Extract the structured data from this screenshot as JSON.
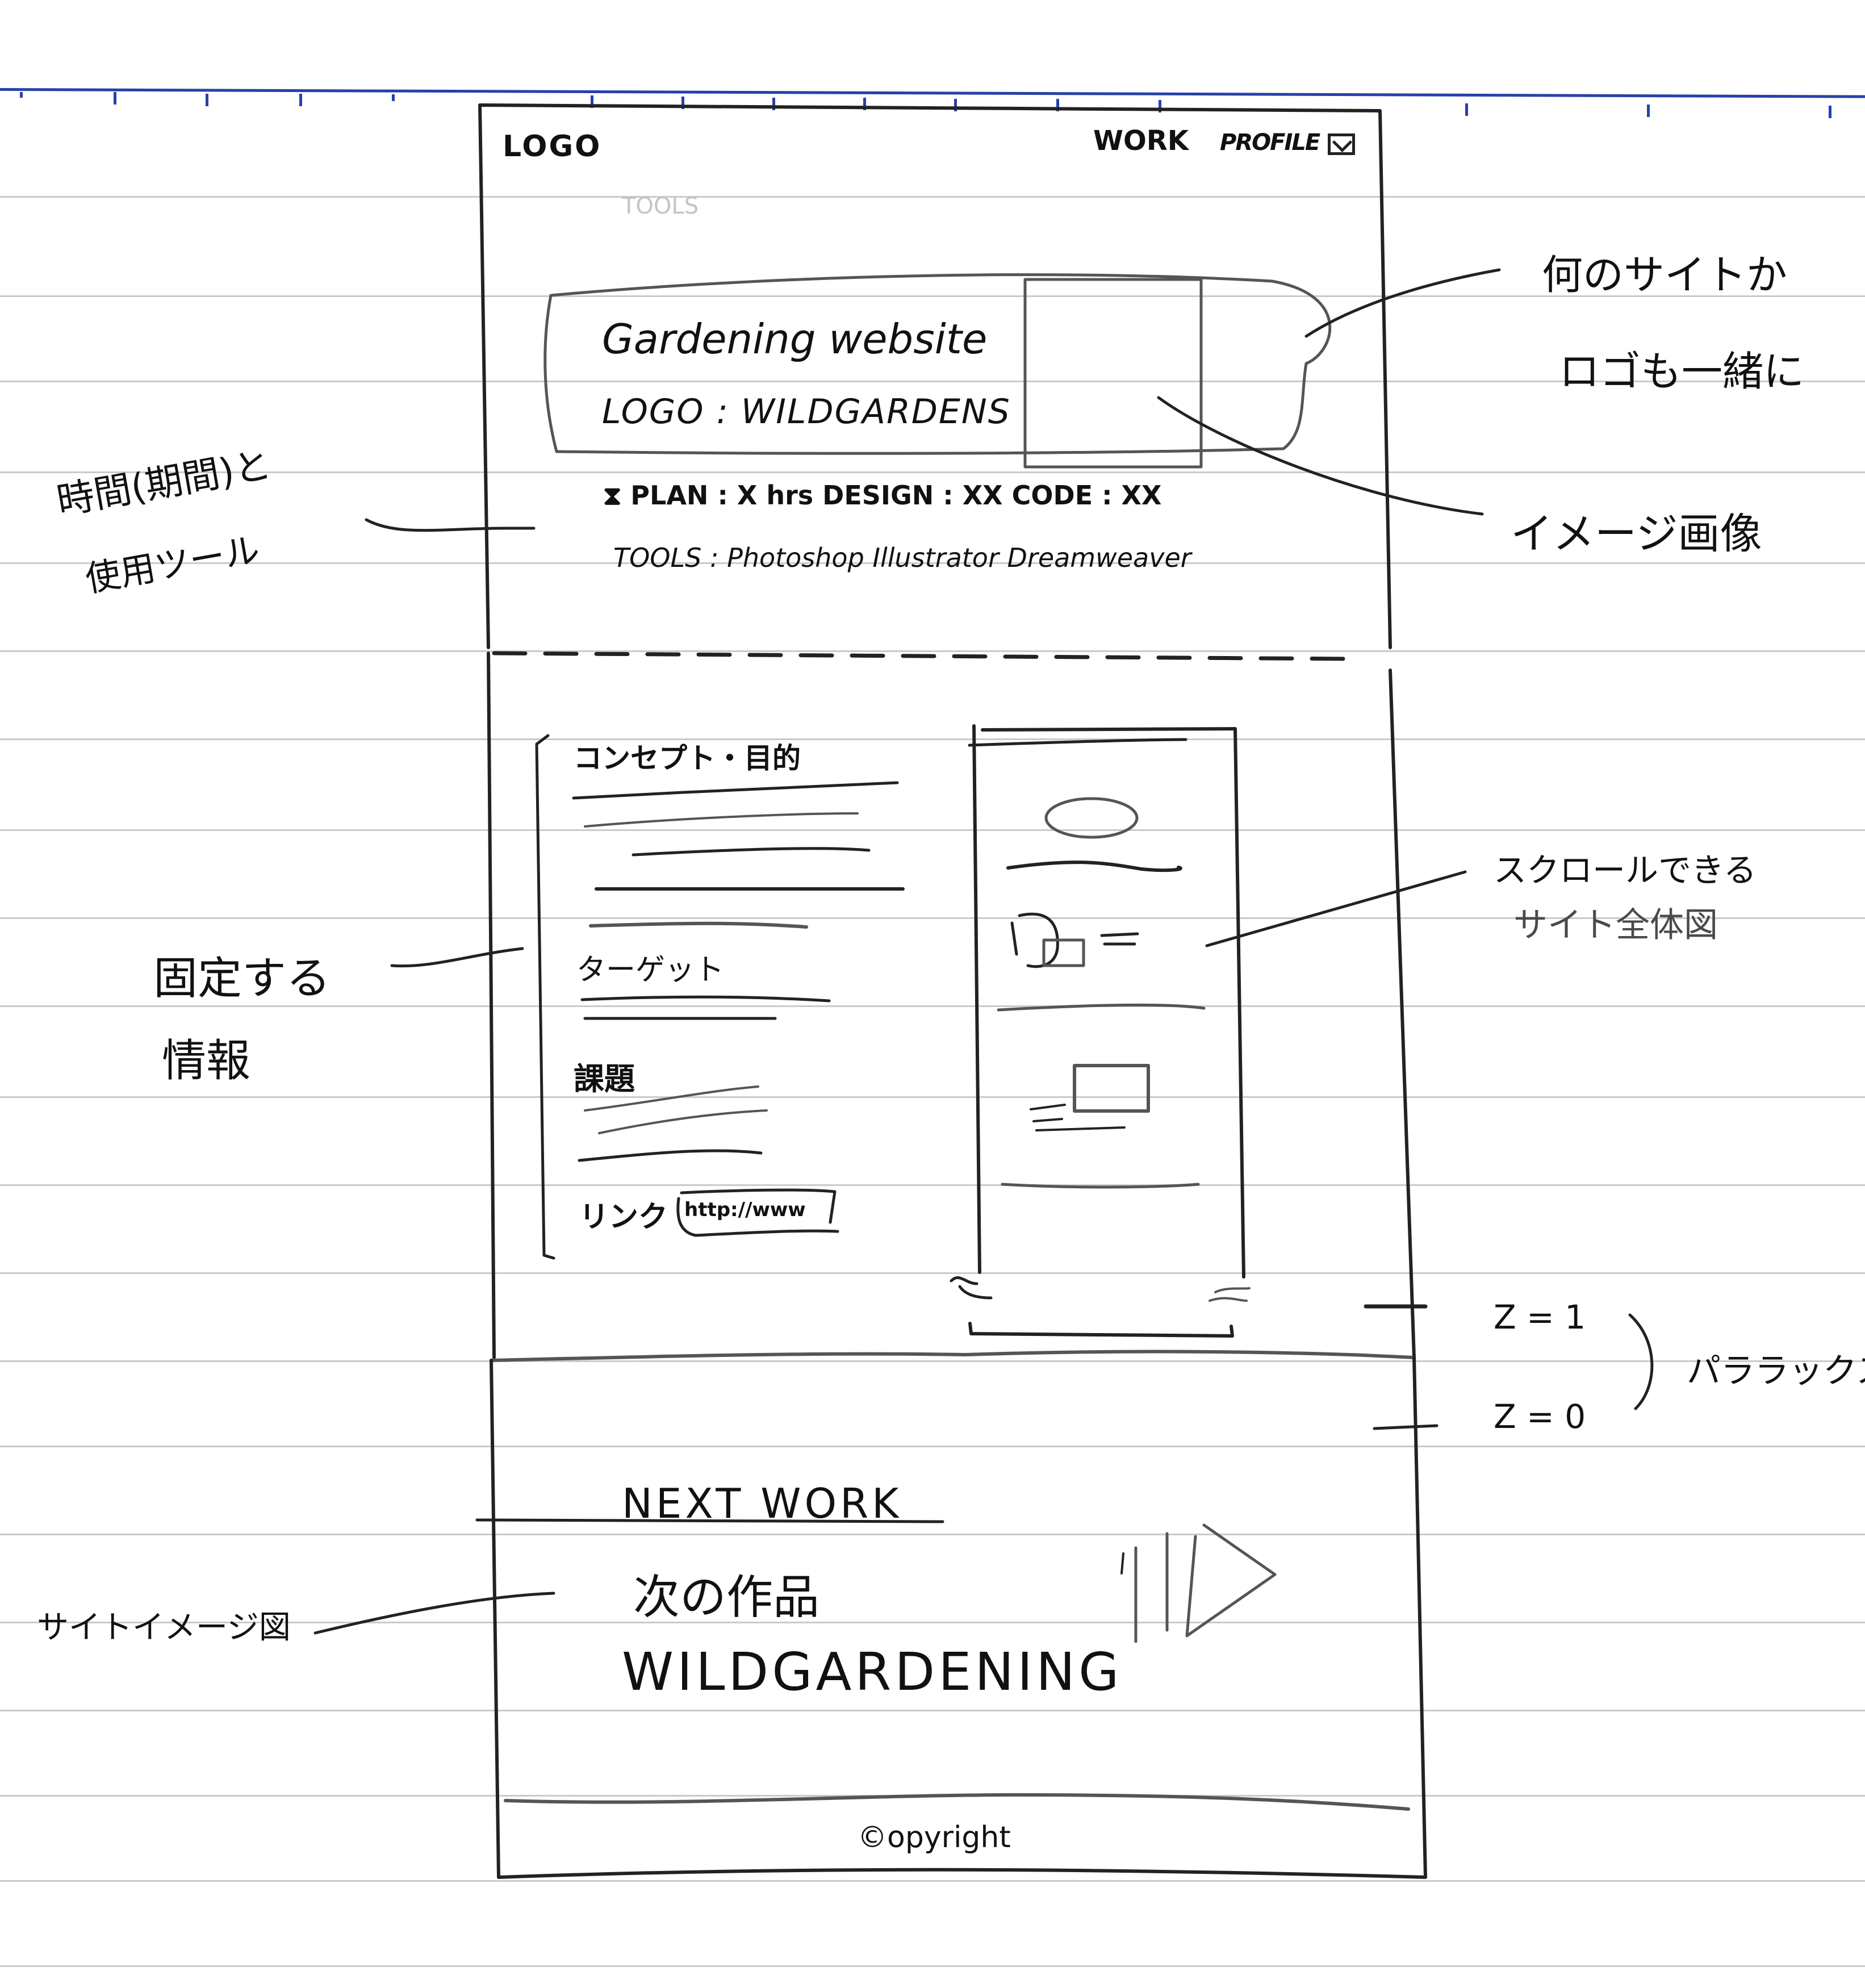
{
  "header": {
    "logo": "LOGO",
    "nav": [
      "WORK",
      "PROFILE"
    ],
    "mail_icon": "mail-icon"
  },
  "faint_text": "TOOLS",
  "hero": {
    "title": "Gardening website",
    "logo_line": "LOGO : WILDGARDENS",
    "image_placeholder": "image-placeholder"
  },
  "meta": {
    "time_line": "⧗ PLAN : X hrs   DESIGN : XX   CODE : XX",
    "tools_line": "TOOLS : Photoshop   Illustrator   Dreamweaver"
  },
  "info_panel": {
    "sections": [
      {
        "heading": "コンセプト・目的",
        "lines": 5
      },
      {
        "heading": "ターゲット",
        "lines": 2
      },
      {
        "heading": "課題",
        "lines": 3
      }
    ],
    "link_label": "リンク",
    "link_value": "http://www"
  },
  "scroll_preview": "site-preview",
  "next": {
    "heading": "NEXT WORK",
    "jp": "次の作品",
    "title": "WILDGARDENING",
    "arrow_icon": "next-arrow-icon"
  },
  "footer": {
    "copyright": "©opyright"
  },
  "annotations": {
    "site_and_logo": [
      "何のサイトか",
      "ロゴも一緒に"
    ],
    "image": "イメージ画像",
    "time_tools": [
      "時間(期間)と",
      "使用ツール"
    ],
    "fixed_info": [
      "固定する",
      "情報"
    ],
    "scroll_preview": [
      "スクロールできる",
      "サイト全体図"
    ],
    "z1": "Z = 1",
    "z0": "Z = 0",
    "parallax": "パララックス",
    "site_image": "サイトイメージ図"
  }
}
